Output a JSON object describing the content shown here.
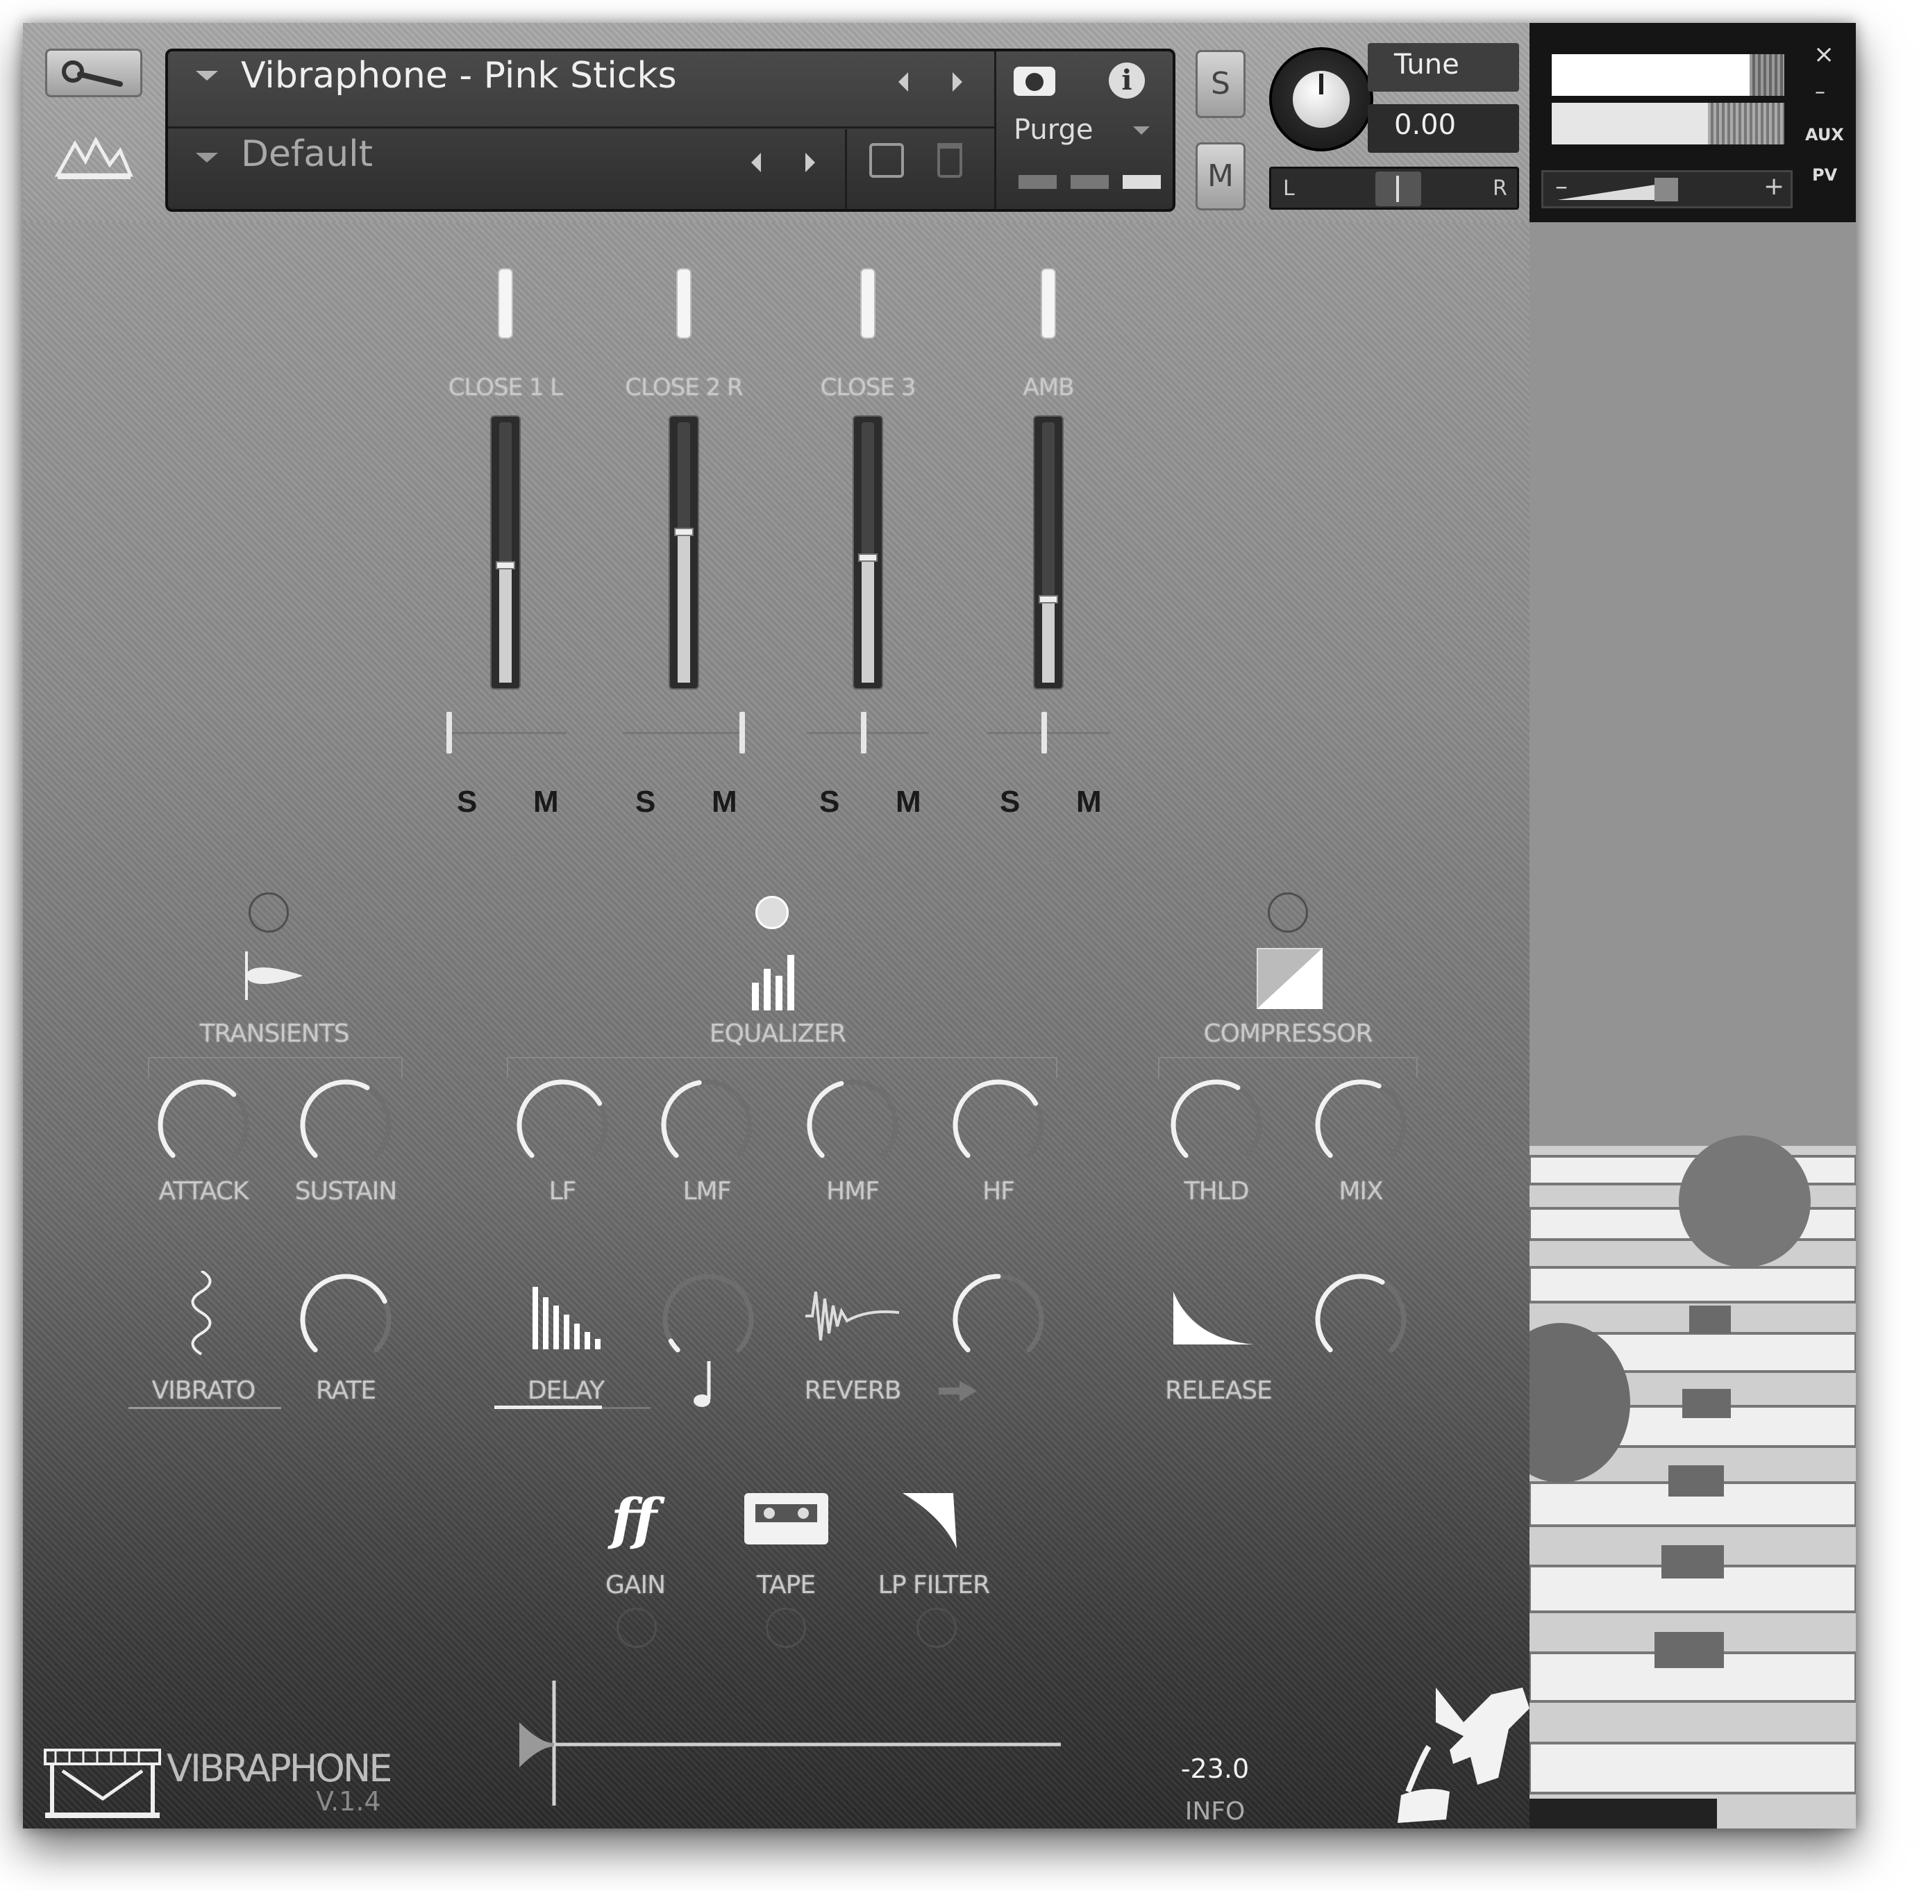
{
  "header": {
    "instrument_name": "Vibraphone - Pink Sticks",
    "snapshot_name": "Default",
    "purge_label": "Purge",
    "solo_label": "S",
    "mute_label": "M",
    "tune_label": "Tune",
    "tune_value": "0.00",
    "pan_left": "L",
    "pan_right": "R",
    "aux_label": "AUX",
    "pv_label": "PV",
    "close_glyph": "×",
    "minimize_glyph": "–",
    "vol_minus": "–",
    "vol_plus": "+"
  },
  "mixer": {
    "channels": [
      {
        "name": "CLOSE 1 L",
        "solo": "S",
        "mute": "M",
        "level": 0.45
      },
      {
        "name": "CLOSE 2 R",
        "solo": "S",
        "mute": "M",
        "level": 0.58
      },
      {
        "name": "CLOSE 3",
        "solo": "S",
        "mute": "M",
        "level": 0.48
      },
      {
        "name": "AMB",
        "solo": "S",
        "mute": "M",
        "level": 0.32
      }
    ]
  },
  "effects": {
    "transients": {
      "label": "TRANSIENTS",
      "knobs": [
        "ATTACK",
        "SUSTAIN"
      ]
    },
    "equalizer": {
      "label": "EQUALIZER",
      "knobs": [
        "LF",
        "LMF",
        "HMF",
        "HF"
      ]
    },
    "compressor": {
      "label": "COMPRESSOR",
      "knobs": [
        "THLD",
        "MIX"
      ]
    },
    "vibrato": {
      "label": "VIBRATO",
      "rate": "RATE"
    },
    "delay": {
      "label": "DELAY"
    },
    "reverb": {
      "label": "REVERB"
    },
    "release": {
      "label": "RELEASE"
    },
    "gain": {
      "label": "GAIN",
      "icon_text": "ff"
    },
    "tape": {
      "label": "TAPE"
    },
    "lpfilter": {
      "label": "LP FILTER"
    }
  },
  "footer": {
    "product": "VIBRAPHONE",
    "version": "V.1.4",
    "value": "-23.0",
    "info": "INFO"
  }
}
